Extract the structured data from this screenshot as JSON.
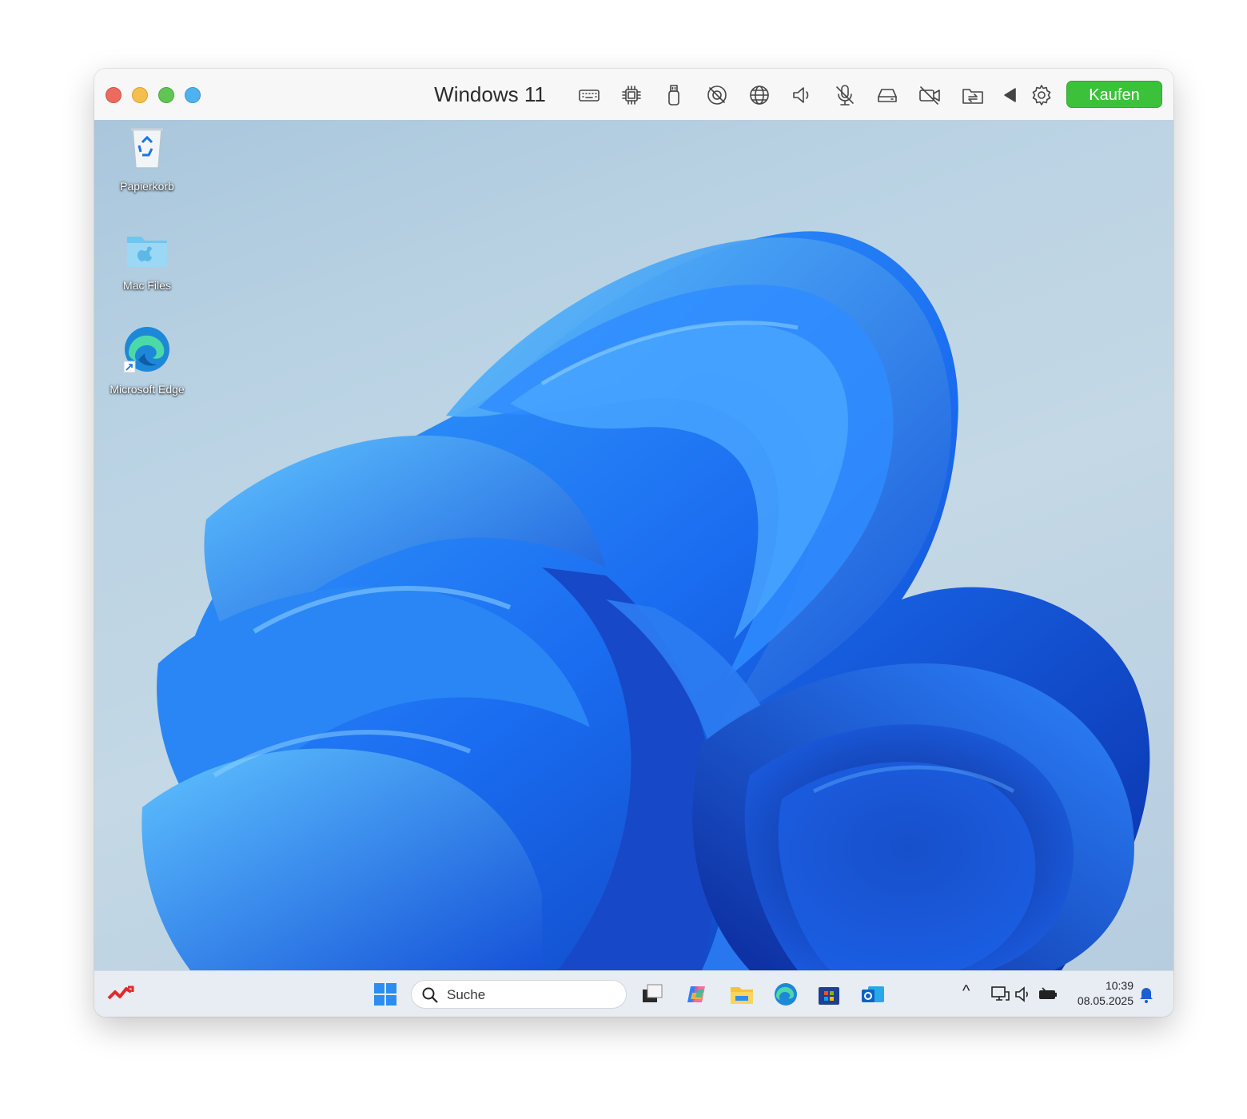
{
  "window": {
    "title": "Windows 11",
    "traffic_lights": [
      "close",
      "minimize",
      "zoom",
      "extra"
    ],
    "toolbar_icons": [
      "keyboard-icon",
      "cpu-icon",
      "usb-icon",
      "no-camera-icon",
      "network-icon",
      "speaker-icon",
      "microphone-icon",
      "drive-icon",
      "camera-off-icon",
      "shared-folder-icon",
      "play-back-icon",
      "settings-gear-icon"
    ],
    "buy_button": "Kaufen",
    "buy_button_color": "#3cc23a"
  },
  "desktop": {
    "icons": [
      {
        "label": "Papierkorb",
        "icon": "recycle-bin-icon"
      },
      {
        "label": "Mac Files",
        "icon": "mac-folder-icon"
      },
      {
        "label": "Microsoft Edge",
        "icon": "edge-icon"
      }
    ],
    "wallpaper": "windows-11-bloom",
    "accent": "#1a6cf0"
  },
  "taskbar": {
    "search_placeholder": "Suche",
    "apps": [
      "start-icon",
      "task-view-icon",
      "copilot-icon",
      "file-explorer-icon",
      "edge-icon",
      "store-icon",
      "outlook-icon"
    ],
    "tray": {
      "chevron": "^",
      "icons": [
        "network-icon",
        "volume-icon",
        "battery-icon"
      ],
      "time": "10:39",
      "date": "08.05.2025"
    }
  }
}
